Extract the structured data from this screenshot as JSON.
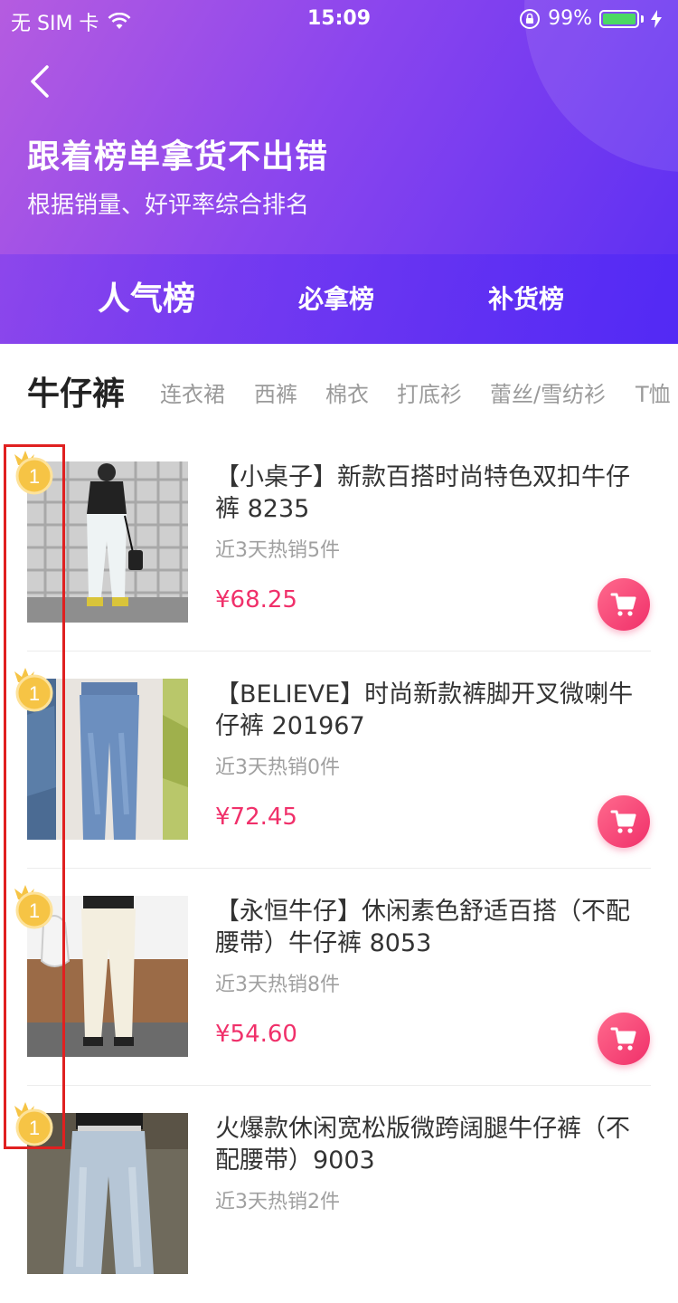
{
  "status_bar": {
    "carrier": "无 SIM 卡",
    "time": "15:09",
    "battery_percent": "99%",
    "battery_level": 0.99
  },
  "header": {
    "title": "跟着榜单拿货不出错",
    "subtitle": "根据销量、好评率综合排名",
    "background_from": "#b55ce0",
    "background_to": "#5a2ef3"
  },
  "rank_tabs": [
    {
      "label": "人气榜",
      "active": true
    },
    {
      "label": "必拿榜",
      "active": false
    },
    {
      "label": "补货榜",
      "active": false
    }
  ],
  "categories": [
    {
      "label": "牛仔裤",
      "active": true
    },
    {
      "label": "连衣裙"
    },
    {
      "label": "西裤"
    },
    {
      "label": "棉衣"
    },
    {
      "label": "打底衫"
    },
    {
      "label": "蕾丝/雪纺衫"
    },
    {
      "label": "T恤"
    }
  ],
  "products": [
    {
      "rank": "1",
      "title": "【小桌子】新款百搭时尚特色双扣牛仔裤 8235",
      "sales": "近3天热销5件",
      "price": "¥68.25",
      "image": "woman-white-jeans-photo"
    },
    {
      "rank": "1",
      "title": "【BELIEVE】时尚新款裤脚开叉微喇牛仔裤 201967",
      "sales": "近3天热销0件",
      "price": "¥72.45",
      "image": "blue-flared-jeans-photo"
    },
    {
      "rank": "1",
      "title": "【永恒牛仔】休闲素色舒适百搭（不配腰带）牛仔裤 8053",
      "sales": "近3天热销8件",
      "price": "¥54.60",
      "image": "cream-straight-jeans-photo"
    },
    {
      "rank": "1",
      "title": "火爆款休闲宽松版微跨阔腿牛仔裤（不配腰带）9003",
      "sales": "近3天热销2件",
      "price": "",
      "image": "light-wide-leg-jeans-photo"
    }
  ],
  "colors": {
    "accent_price": "#f0306a",
    "cart_button": "#f0306a",
    "medal": "#f6c445",
    "annotation_box": "#e02020"
  },
  "icons": {
    "back": "chevron-left-icon",
    "cart": "cart-icon",
    "medal": "gold-medal-icon",
    "wifi": "wifi-icon",
    "lock": "rotation-lock-icon",
    "charging": "bolt-icon"
  }
}
